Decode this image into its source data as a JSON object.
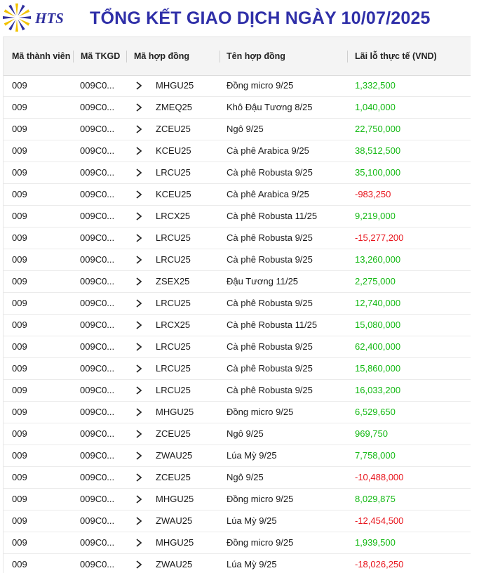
{
  "header": {
    "logo_text": "HTS",
    "title": "TỔNG KẾT GIAO DỊCH NGÀY 10/07/2025"
  },
  "colors": {
    "title": "#2f2fa8",
    "profit": "#12b912",
    "loss": "#e8141c",
    "logo_blue": "#2f2f9e",
    "logo_yellow": "#f2c200"
  },
  "table": {
    "columns": {
      "member": "Mã thành viên",
      "account": "Mã TKGD",
      "contract_code": "Mã hợp đồng",
      "contract_name": "Tên hợp đồng",
      "pnl": "Lãi lỗ thực tế (VND)"
    },
    "rows": [
      {
        "member": "009",
        "account": "009C0...",
        "code": "MHGU25",
        "name": "Đồng micro 9/25",
        "pnl": "1,332,500",
        "sign": "pos"
      },
      {
        "member": "009",
        "account": "009C0...",
        "code": "ZMEQ25",
        "name": "Khô Đậu Tương 8/25",
        "pnl": "1,040,000",
        "sign": "pos"
      },
      {
        "member": "009",
        "account": "009C0...",
        "code": "ZCEU25",
        "name": "Ngô 9/25",
        "pnl": "22,750,000",
        "sign": "pos"
      },
      {
        "member": "009",
        "account": "009C0...",
        "code": "KCEU25",
        "name": "Cà phê Arabica 9/25",
        "pnl": "38,512,500",
        "sign": "pos"
      },
      {
        "member": "009",
        "account": "009C0...",
        "code": "LRCU25",
        "name": "Cà phê Robusta 9/25",
        "pnl": "35,100,000",
        "sign": "pos"
      },
      {
        "member": "009",
        "account": "009C0...",
        "code": "KCEU25",
        "name": "Cà phê Arabica 9/25",
        "pnl": "-983,250",
        "sign": "neg"
      },
      {
        "member": "009",
        "account": "009C0...",
        "code": "LRCX25",
        "name": "Cà phê Robusta 11/25",
        "pnl": "9,219,000",
        "sign": "pos"
      },
      {
        "member": "009",
        "account": "009C0...",
        "code": "LRCU25",
        "name": "Cà phê Robusta 9/25",
        "pnl": "-15,277,200",
        "sign": "neg"
      },
      {
        "member": "009",
        "account": "009C0...",
        "code": "LRCU25",
        "name": "Cà phê Robusta 9/25",
        "pnl": "13,260,000",
        "sign": "pos"
      },
      {
        "member": "009",
        "account": "009C0...",
        "code": "ZSEX25",
        "name": "Đậu Tương 11/25",
        "pnl": "2,275,000",
        "sign": "pos"
      },
      {
        "member": "009",
        "account": "009C0...",
        "code": "LRCU25",
        "name": "Cà phê Robusta 9/25",
        "pnl": "12,740,000",
        "sign": "pos"
      },
      {
        "member": "009",
        "account": "009C0...",
        "code": "LRCX25",
        "name": "Cà phê Robusta 11/25",
        "pnl": "15,080,000",
        "sign": "pos"
      },
      {
        "member": "009",
        "account": "009C0...",
        "code": "LRCU25",
        "name": "Cà phê Robusta 9/25",
        "pnl": "62,400,000",
        "sign": "pos"
      },
      {
        "member": "009",
        "account": "009C0...",
        "code": "LRCU25",
        "name": "Cà phê Robusta 9/25",
        "pnl": "15,860,000",
        "sign": "pos"
      },
      {
        "member": "009",
        "account": "009C0...",
        "code": "LRCU25",
        "name": "Cà phê Robusta 9/25",
        "pnl": "16,033,200",
        "sign": "pos"
      },
      {
        "member": "009",
        "account": "009C0...",
        "code": "MHGU25",
        "name": "Đồng micro 9/25",
        "pnl": "6,529,650",
        "sign": "pos"
      },
      {
        "member": "009",
        "account": "009C0...",
        "code": "ZCEU25",
        "name": "Ngô 9/25",
        "pnl": "969,750",
        "sign": "pos"
      },
      {
        "member": "009",
        "account": "009C0...",
        "code": "ZWAU25",
        "name": "Lúa Mỳ 9/25",
        "pnl": "7,758,000",
        "sign": "pos"
      },
      {
        "member": "009",
        "account": "009C0...",
        "code": "ZCEU25",
        "name": "Ngô 9/25",
        "pnl": "-10,488,000",
        "sign": "neg"
      },
      {
        "member": "009",
        "account": "009C0...",
        "code": "MHGU25",
        "name": "Đồng micro 9/25",
        "pnl": "8,029,875",
        "sign": "pos"
      },
      {
        "member": "009",
        "account": "009C0...",
        "code": "ZWAU25",
        "name": "Lúa Mỳ 9/25",
        "pnl": "-12,454,500",
        "sign": "neg"
      },
      {
        "member": "009",
        "account": "009C0...",
        "code": "MHGU25",
        "name": "Đồng micro 9/25",
        "pnl": "1,939,500",
        "sign": "pos"
      },
      {
        "member": "009",
        "account": "009C0...",
        "code": "ZWAU25",
        "name": "Lúa Mỳ 9/25",
        "pnl": "-18,026,250",
        "sign": "neg"
      }
    ]
  }
}
